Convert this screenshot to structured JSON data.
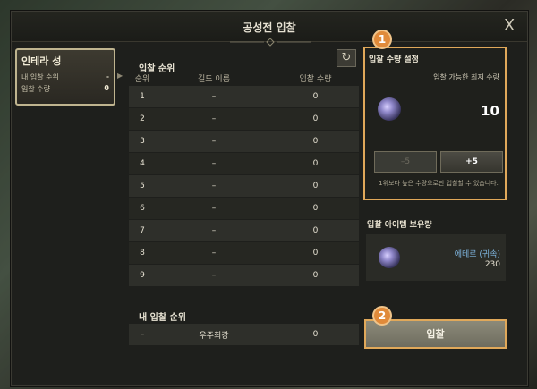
{
  "window": {
    "title": "공성전 입찰",
    "close_glyph": "X"
  },
  "castle": {
    "name": "인테라 성",
    "my_rank_label": "내 입찰 순위",
    "my_rank_value": "–",
    "bid_amount_label": "입찰 수량",
    "bid_amount_value": "0"
  },
  "ranking": {
    "title": "입찰 순위",
    "columns": [
      "순위",
      "길드 이름",
      "입찰 수량"
    ],
    "rows": [
      {
        "rank": "1",
        "guild": "–",
        "amount": "0"
      },
      {
        "rank": "2",
        "guild": "–",
        "amount": "0"
      },
      {
        "rank": "3",
        "guild": "–",
        "amount": "0"
      },
      {
        "rank": "4",
        "guild": "–",
        "amount": "0"
      },
      {
        "rank": "5",
        "guild": "–",
        "amount": "0"
      },
      {
        "rank": "6",
        "guild": "–",
        "amount": "0"
      },
      {
        "rank": "7",
        "guild": "–",
        "amount": "0"
      },
      {
        "rank": "8",
        "guild": "–",
        "amount": "0"
      },
      {
        "rank": "9",
        "guild": "–",
        "amount": "0"
      }
    ],
    "my_title": "내 입찰 순위",
    "my_row": {
      "rank": "–",
      "guild": "우주최강",
      "amount": "0"
    }
  },
  "bid_setting": {
    "title": "입찰 수량 설정",
    "min_label": "입찰 가능한 최저 수량",
    "amount": "10",
    "minus_label": "–5",
    "plus_label": "+5",
    "hint": "1위보다 높은 수량으로만 입찰할 수 있습니다."
  },
  "holding": {
    "title": "입찰 아이템 보유량",
    "item_name": "에테르 (귀속)",
    "item_qty": "230"
  },
  "bid_button": {
    "label": "입찰"
  },
  "badges": {
    "one": "1",
    "two": "2"
  },
  "icons": {
    "close": "close-icon",
    "refresh": "refresh-icon",
    "crystal": "ether-crystal-icon"
  },
  "colors": {
    "highlight": "#e0a85a",
    "badge": "#e08a3a",
    "item_name": "#7fb6e0"
  }
}
